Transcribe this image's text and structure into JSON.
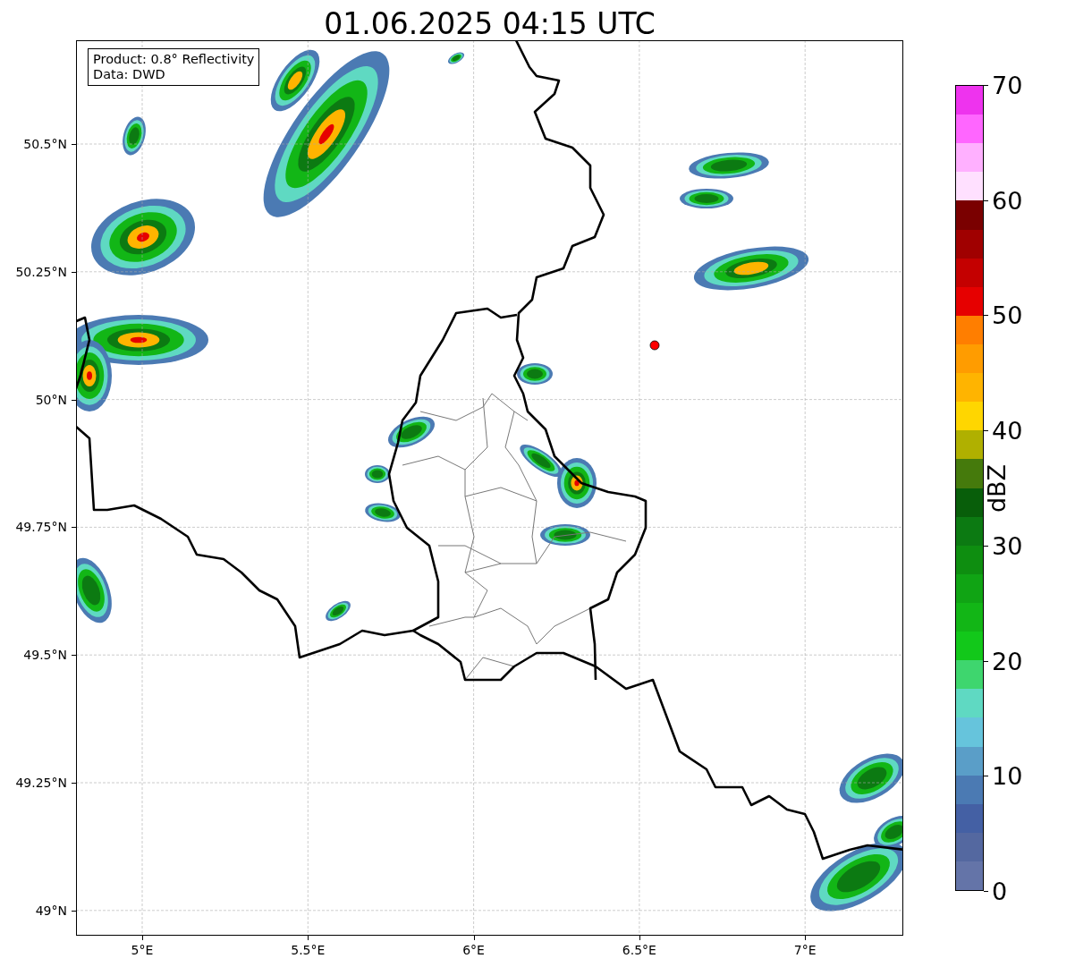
{
  "title": "01.06.2025 04:15 UTC",
  "map": {
    "info_box": [
      "Product: 0.8° Reflectivity",
      "Data: DWD"
    ],
    "lat_labels": [
      "50.5°N",
      "50.25°N",
      "50°N",
      "49.75°N",
      "49.5°N",
      "49.25°N",
      "49°N"
    ],
    "lon_labels": [
      "5°E",
      "5.5°E",
      "6°E",
      "6.5°E",
      "7°E"
    ]
  },
  "colorbar": {
    "label": "dBZ",
    "ticks": [
      "70",
      "60",
      "50",
      "40",
      "30",
      "20",
      "10",
      "0"
    ],
    "bands": [
      {
        "color": "#ee33ee"
      },
      {
        "color": "#ff66ff"
      },
      {
        "color": "#ffb0ff"
      },
      {
        "color": "#ffe0ff"
      },
      {
        "color": "#7a0000"
      },
      {
        "color": "#a00000"
      },
      {
        "color": "#c40000"
      },
      {
        "color": "#e60000"
      },
      {
        "color": "#ff7e00"
      },
      {
        "color": "#ff9c00"
      },
      {
        "color": "#ffb400"
      },
      {
        "color": "#ffd600"
      },
      {
        "color": "#b0b000"
      },
      {
        "color": "#457a0c"
      },
      {
        "color": "#085e0a"
      },
      {
        "color": "#0c7a12"
      },
      {
        "color": "#0e8e10"
      },
      {
        "color": "#10a414"
      },
      {
        "color": "#12b616"
      },
      {
        "color": "#12c81a"
      },
      {
        "color": "#3ed66e"
      },
      {
        "color": "#5fd9c2"
      },
      {
        "color": "#66c4dc"
      },
      {
        "color": "#5a9ec8"
      },
      {
        "color": "#4b7ab3"
      },
      {
        "color": "#4460a4"
      },
      {
        "color": "#5468a0"
      },
      {
        "color": "#6474a8"
      }
    ]
  }
}
